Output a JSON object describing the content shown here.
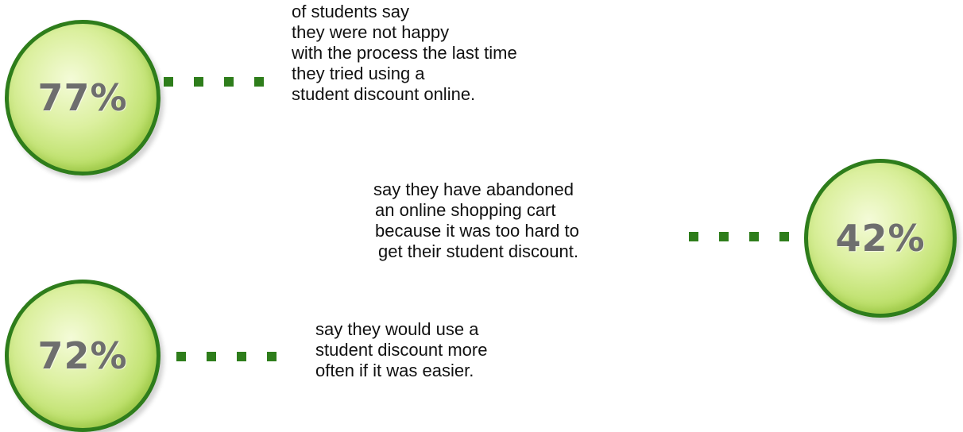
{
  "stats": [
    {
      "value": "77%",
      "caption": [
        "of students say",
        "they were not happy",
        "with the process the last time",
        "they tried using a",
        "student discount online."
      ]
    },
    {
      "value": "42%",
      "caption": [
        "say they have abandoned",
        "an online shopping cart",
        "because it was too hard to",
        "get their student discount."
      ]
    },
    {
      "value": "72%",
      "caption": [
        "say they would use a",
        "student discount more",
        "often if it was easier."
      ]
    }
  ],
  "colors": {
    "accent": "#2e7d1b",
    "circle_fill": "#b9de64",
    "value_text": "#6e6e6e",
    "caption_text": "#111111"
  }
}
